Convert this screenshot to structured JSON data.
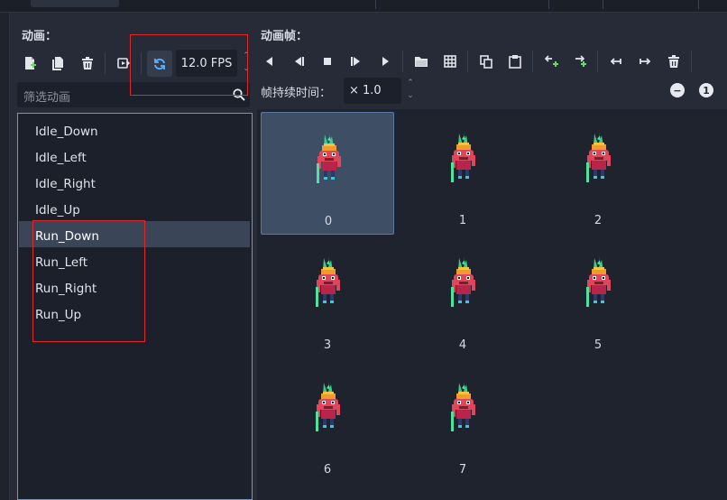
{
  "left_panel": {
    "title": "动画：",
    "fps_value": "12.0 FPS",
    "filter_placeholder": "筛选动画",
    "animations": [
      "Idle_Down",
      "Idle_Left",
      "Idle_Right",
      "Idle_Up",
      "Run_Down",
      "Run_Left",
      "Run_Right",
      "Run_Up"
    ],
    "selected_animation": "Run_Down"
  },
  "right_panel": {
    "title": "动画帧：",
    "duration_label": "帧持续时间：",
    "duration_value": "× 1.0",
    "zoom_out": "−",
    "zoom_reset": "1",
    "frames": [
      "0",
      "1",
      "2",
      "3",
      "4",
      "5",
      "6",
      "7"
    ],
    "selected_frame": "0"
  },
  "colors": {
    "accent": "#5d9cd8",
    "loop_icon": "#5fb2ff",
    "highlight": "#e0282b",
    "add_icon": "#6dd66d"
  }
}
